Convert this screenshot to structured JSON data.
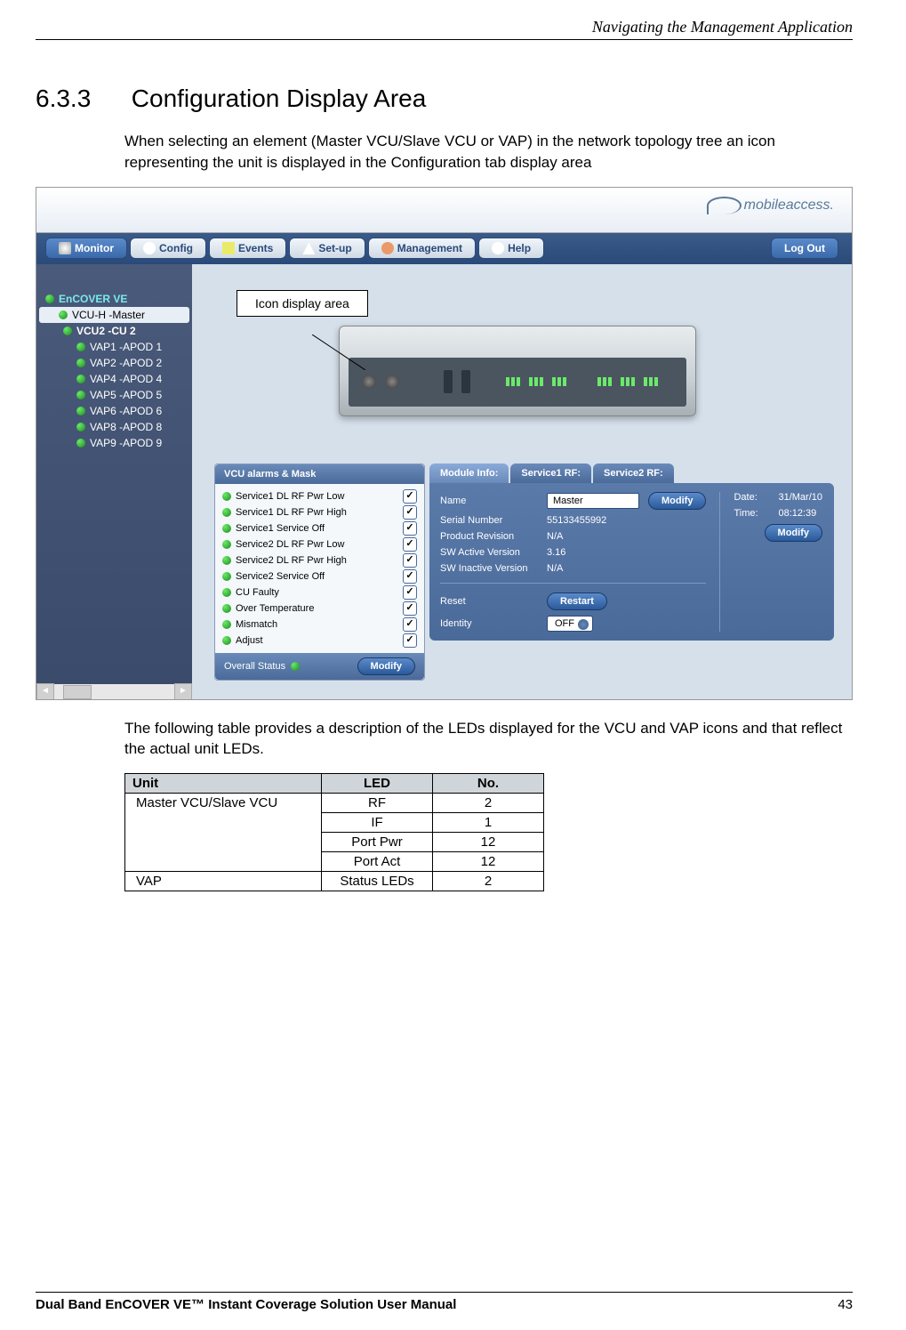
{
  "header": {
    "right": "Navigating the Management Application"
  },
  "section": {
    "number": "6.3.3",
    "title": "Configuration Display Area"
  },
  "paragraphs": {
    "p1": "When selecting an element (Master VCU/Slave VCU or VAP) in the network topology tree an icon representing the unit is displayed in the Configuration tab display area",
    "p2": "The following table provides a description of the LEDs displayed for the VCU and VAP icons and that reflect the actual unit LEDs."
  },
  "callout": {
    "label": "Icon display area"
  },
  "app": {
    "logo": "mobileaccess.",
    "tabs": {
      "monitor": "Monitor",
      "config": "Config",
      "events": "Events",
      "setup": "Set-up",
      "management": "Management",
      "help": "Help"
    },
    "logout": "Log Out"
  },
  "tree": {
    "root": "EnCOVER VE",
    "items": [
      "VCU-H -Master",
      "VCU2 -CU 2",
      "VAP1 -APOD 1",
      "VAP2 -APOD 2",
      "VAP4 -APOD 4",
      "VAP5 -APOD 5",
      "VAP6 -APOD 6",
      "VAP8 -APOD 8",
      "VAP9 -APOD 9"
    ]
  },
  "alarms": {
    "header": "VCU alarms & Mask",
    "items": [
      "Service1 DL RF Pwr Low",
      "Service1 DL RF Pwr High",
      "Service1 Service Off",
      "Service2 DL RF Pwr Low",
      "Service2 DL RF Pwr High",
      "Service2 Service Off",
      "CU Faulty",
      "Over Temperature",
      "Mismatch",
      "Adjust"
    ],
    "footer_label": "Overall Status",
    "modify": "Modify"
  },
  "info": {
    "tabs": {
      "module": "Module Info:",
      "service1": "Service1 RF:",
      "service2": "Service2 RF:"
    },
    "fields": {
      "name_label": "Name",
      "name_value": "Master",
      "serial_label": "Serial Number",
      "serial_value": "55133455992",
      "revision_label": "Product Revision",
      "revision_value": "N/A",
      "swactive_label": "SW Active Version",
      "swactive_value": "3.16",
      "swinactive_label": "SW Inactive Version",
      "swinactive_value": "N/A",
      "reset_label": "Reset",
      "restart": "Restart",
      "identity_label": "Identity",
      "identity_value": "OFF"
    },
    "datetime": {
      "date_label": "Date:",
      "date_value": "31/Mar/10",
      "time_label": "Time:",
      "time_value": "08:12:39"
    },
    "modify": "Modify"
  },
  "table": {
    "headers": {
      "unit": "Unit",
      "led": "LED",
      "no": "No."
    },
    "rows": {
      "unit1": "Master VCU/Slave VCU",
      "r1_led": "RF",
      "r1_no": "2",
      "r2_led": "IF",
      "r2_no": "1",
      "r3_led": "Port Pwr",
      "r3_no": "12",
      "r4_led": "Port Act",
      "r4_no": "12",
      "unit2": "VAP",
      "r5_led": "Status LEDs",
      "r5_no": "2"
    }
  },
  "footer": {
    "left": "Dual Band EnCOVER VE™ Instant Coverage Solution User Manual",
    "right": "43"
  }
}
